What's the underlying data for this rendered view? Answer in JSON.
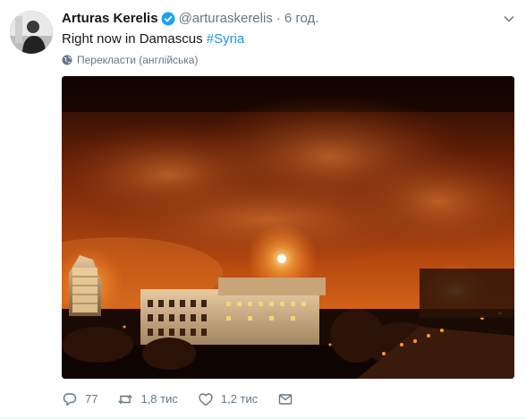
{
  "tweet": {
    "author_name": "Arturas Kerelis",
    "handle": "@arturaskerelis",
    "separator": "·",
    "time": "6 год.",
    "text_main": "Right now in Damascus ",
    "hashtag": "#Syria",
    "translate_label": "Перекласти (англійська)"
  },
  "actions": {
    "replies": "77",
    "retweets": "1,8 тис",
    "likes": "1,2 тис"
  },
  "colors": {
    "link": "#1b95e0",
    "muted": "#657786",
    "verified": "#1da1f2"
  },
  "icons": [
    "verified-badge-icon",
    "chevron-down-icon",
    "globe-icon",
    "reply-icon",
    "retweet-icon",
    "like-icon",
    "direct-message-icon"
  ]
}
